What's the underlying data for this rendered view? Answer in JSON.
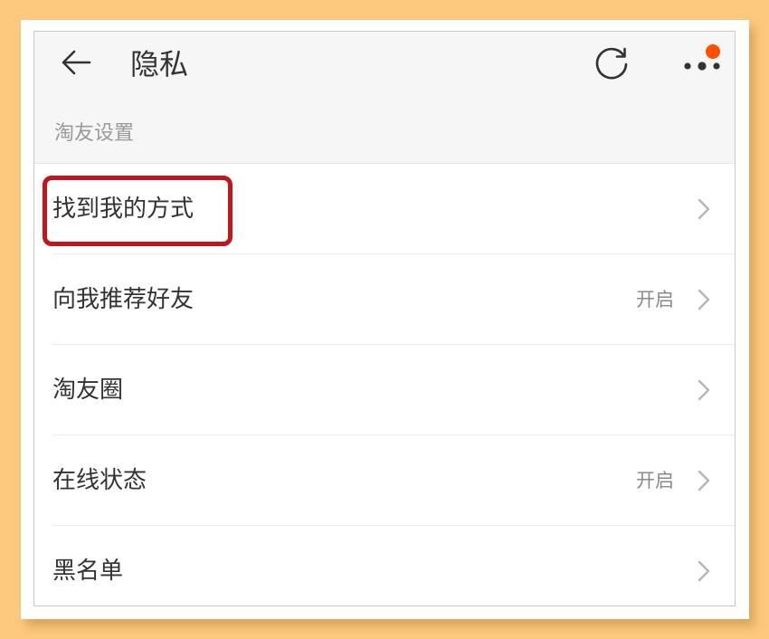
{
  "colors": {
    "backdrop": "#fdc97e",
    "header_bg": "#f6f6f6",
    "notification_dot": "#ff5000",
    "highlight_border": "#c0161c"
  },
  "header": {
    "back_icon": "arrow-left-icon",
    "title": "隐私",
    "refresh_icon": "refresh-icon",
    "more_icon": "more-dots-icon",
    "has_notification": true
  },
  "section": {
    "label": "淘友设置"
  },
  "rows": [
    {
      "label": "找到我的方式",
      "value": "",
      "highlighted": true
    },
    {
      "label": "向我推荐好友",
      "value": "开启"
    },
    {
      "label": "淘友圈",
      "value": ""
    },
    {
      "label": "在线状态",
      "value": "开启"
    },
    {
      "label": "黑名单",
      "value": ""
    }
  ]
}
